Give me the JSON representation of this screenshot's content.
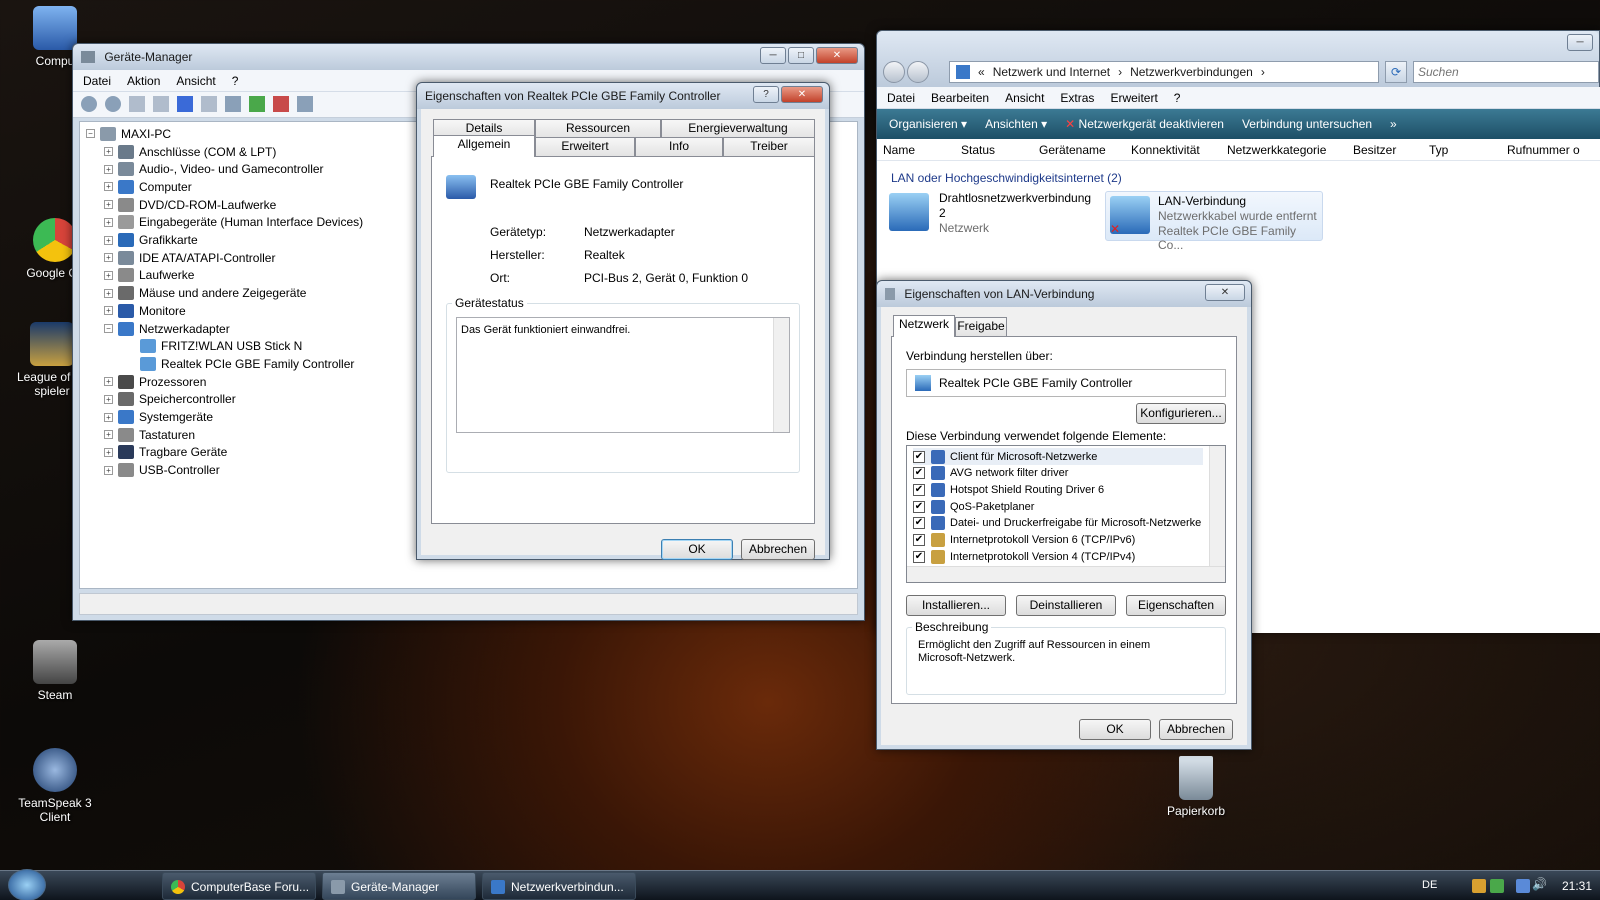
{
  "desktop": {
    "icons": [
      {
        "label": "Compu",
        "color": "#3a78c8"
      },
      {
        "label": "Google Ch",
        "color": "#d8443a"
      },
      {
        "label": "League of Le spieler",
        "color": "#c8a040"
      },
      {
        "label": "Steam",
        "color": "#6a6a6a"
      },
      {
        "label": "TeamSpeak 3 Client",
        "color": "#3a6aa8"
      },
      {
        "label": "Papierkorb",
        "color": "#9aaab8"
      }
    ]
  },
  "device_manager": {
    "title": "Geräte-Manager",
    "menu": [
      "Datei",
      "Aktion",
      "Ansicht",
      "?"
    ],
    "root": "MAXI-PC",
    "tree": [
      "Anschlüsse (COM & LPT)",
      "Audio-, Video- und Gamecontroller",
      "Computer",
      "DVD/CD-ROM-Laufwerke",
      "Eingabegeräte (Human Interface Devices)",
      "Grafikkarte",
      "IDE ATA/ATAPI-Controller",
      "Laufwerke",
      "Mäuse und andere Zeigegeräte",
      "Monitore",
      "Netzwerkadapter",
      "FRITZ!WLAN USB Stick N",
      "Realtek PCIe GBE Family Controller",
      "Prozessoren",
      "Speichercontroller",
      "Systemgeräte",
      "Tastaturen",
      "Tragbare Geräte",
      "USB-Controller"
    ]
  },
  "realtek_props": {
    "title": "Eigenschaften von Realtek PCIe GBE Family Controller",
    "tabs_row1": [
      "Details",
      "Ressourcen",
      "Energieverwaltung"
    ],
    "tabs_row2": [
      "Allgemein",
      "Erweitert",
      "Info",
      "Treiber"
    ],
    "device_name": "Realtek PCIe GBE Family Controller",
    "fields": [
      {
        "label": "Gerätetyp:",
        "value": "Netzwerkadapter"
      },
      {
        "label": "Hersteller:",
        "value": "Realtek"
      },
      {
        "label": "Ort:",
        "value": "PCI-Bus 2, Gerät 0, Funktion 0"
      }
    ],
    "status_legend": "Gerätestatus",
    "status_text": "Das Gerät funktioniert einwandfrei.",
    "ok": "OK",
    "cancel": "Abbrechen"
  },
  "network_connections": {
    "breadcrumb": [
      "«",
      "Netzwerk und Internet",
      "Netzwerkverbindungen"
    ],
    "search_placeholder": "Suchen",
    "menu": [
      "Datei",
      "Bearbeiten",
      "Ansicht",
      "Extras",
      "Erweitert",
      "?"
    ],
    "toolbar": [
      "Organisieren",
      "Ansichten",
      "Netzwerkgerät deaktivieren",
      "Verbindung untersuchen",
      "»"
    ],
    "columns": [
      "Name",
      "Status",
      "Gerätename",
      "Konnektivität",
      "Netzwerkkategorie",
      "Besitzer",
      "Typ",
      "Rufnummer o"
    ],
    "group": "LAN oder Hochgeschwindigkeitsinternet (2)",
    "connections": [
      {
        "name": "Drahtlosnetzwerkverbindung",
        "line2": "2",
        "line3": "Netzwerk"
      },
      {
        "name": "LAN-Verbindung",
        "line2": "Netzwerkkabel wurde entfernt",
        "line3": "Realtek PCIe GBE Family Co..."
      }
    ]
  },
  "lan_props": {
    "title": "Eigenschaften von LAN-Verbindung",
    "tabs": [
      "Netzwerk",
      "Freigabe"
    ],
    "connect_via_label": "Verbindung herstellen über:",
    "adapter": "Realtek PCIe GBE Family Controller",
    "configure": "Konfigurieren...",
    "elements_label": "Diese Verbindung verwendet folgende Elemente:",
    "elements": [
      "Client für Microsoft-Netzwerke",
      "AVG network filter driver",
      "Hotspot Shield Routing Driver 6",
      "QoS-Paketplaner",
      "Datei- und Druckerfreigabe für Microsoft-Netzwerke",
      "Internetprotokoll Version 6 (TCP/IPv6)",
      "Internetprotokoll Version 4 (TCP/IPv4)"
    ],
    "install": "Installieren...",
    "uninstall": "Deinstallieren",
    "properties": "Eigenschaften",
    "description_legend": "Beschreibung",
    "description": "Ermöglicht den Zugriff auf Ressourcen in einem Microsoft-Netzwerk.",
    "ok": "OK",
    "cancel": "Abbrechen"
  },
  "taskbar": {
    "buttons": [
      "ComputerBase Foru...",
      "Geräte-Manager",
      "Netzwerkverbindun..."
    ],
    "lang": "DE",
    "clock": "21:31"
  }
}
